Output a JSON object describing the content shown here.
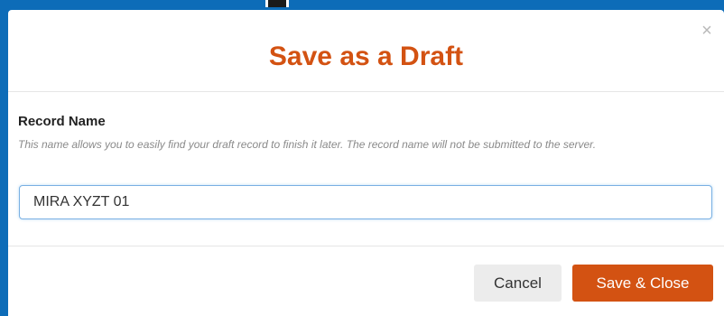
{
  "background": {
    "color": "#0d6cb8"
  },
  "dialog": {
    "title": "Save as a Draft",
    "close_icon": "close-icon",
    "close_glyph": "×",
    "title_color": "#d35212",
    "field": {
      "label": "Record Name",
      "help_text": "This name allows you to easily find your draft record to finish it later. The record name will not be submitted to the server.",
      "value": "MIRA XYZT 01",
      "placeholder": ""
    },
    "buttons": {
      "cancel_label": "Cancel",
      "save_label": "Save & Close",
      "primary_color": "#d35212"
    }
  }
}
